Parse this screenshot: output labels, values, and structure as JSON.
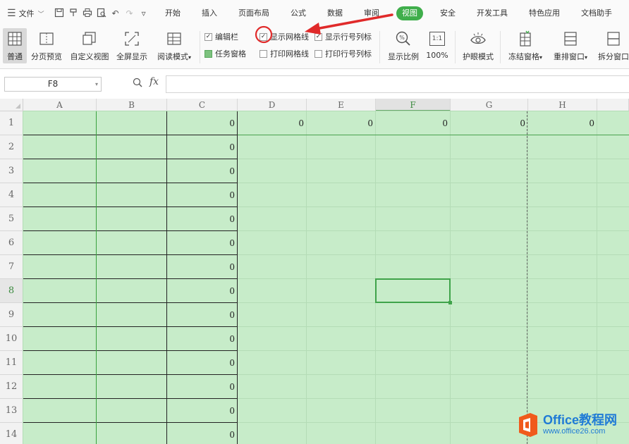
{
  "menubar": {
    "file_label": "文件",
    "tabs": [
      {
        "label": "开始",
        "active": false
      },
      {
        "label": "插入",
        "active": false
      },
      {
        "label": "页面布局",
        "active": false
      },
      {
        "label": "公式",
        "active": false
      },
      {
        "label": "数据",
        "active": false
      },
      {
        "label": "审阅",
        "active": false
      },
      {
        "label": "视图",
        "active": true
      },
      {
        "label": "安全",
        "active": false
      },
      {
        "label": "开发工具",
        "active": false
      },
      {
        "label": "特色应用",
        "active": false
      },
      {
        "label": "文档助手",
        "active": false
      }
    ],
    "active_color": "#3fae4b"
  },
  "ribbon": {
    "normal_label": "普通",
    "page_preview_label": "分页预览",
    "custom_view_label": "自定义视图",
    "fullscreen_label": "全屏显示",
    "reading_mode_label": "阅读模式",
    "checkboxes": {
      "edit_bar": {
        "label": "编辑栏",
        "checked": true
      },
      "task_pane": {
        "label": "任务窗格",
        "checked": true
      },
      "show_gridlines": {
        "label": "显示网格线",
        "checked": true
      },
      "print_gridlines": {
        "label": "打印网格线",
        "checked": false
      },
      "show_row_col_headers": {
        "label": "显示行号列标",
        "checked": true
      },
      "print_row_col_headers": {
        "label": "打印行号列标",
        "checked": false
      }
    },
    "zoom_ratio_label": "显示比例",
    "zoom_100_label": "100%",
    "zoom_100_icon_text": "1:1",
    "eye_mode_label": "护眼模式",
    "freeze_label": "冻结窗格",
    "arrange_label": "重排窗口",
    "split_label": "拆分窗口"
  },
  "formula_bar": {
    "name_box": "F8",
    "fx_label": "fx",
    "formula": ""
  },
  "sheet": {
    "columns": [
      "A",
      "B",
      "C",
      "D",
      "E",
      "F",
      "G",
      "H"
    ],
    "selected_column": "F",
    "rows": [
      "1",
      "2",
      "3",
      "4",
      "5",
      "6",
      "7",
      "8",
      "9",
      "10",
      "11",
      "12",
      "13",
      "14"
    ],
    "selected_row": "8",
    "cells": {
      "C1": "0",
      "D1": "0",
      "E1": "0",
      "F1": "0",
      "G1": "0",
      "H1": "0",
      "C2": "0",
      "C3": "0",
      "C4": "0",
      "C5": "0",
      "C6": "0",
      "C7": "0",
      "C8": "0",
      "C9": "0",
      "C10": "0",
      "C11": "0",
      "C12": "0",
      "C13": "0",
      "C14": "0"
    },
    "sheet_bg_color": "#c7ecc9",
    "selection_color": "#3fa34a"
  },
  "annotation": {
    "color": "#e02a2a"
  },
  "watermark": {
    "title": "Office教程网",
    "url": "www.office26.com",
    "logo_color": "#f05a1c"
  }
}
